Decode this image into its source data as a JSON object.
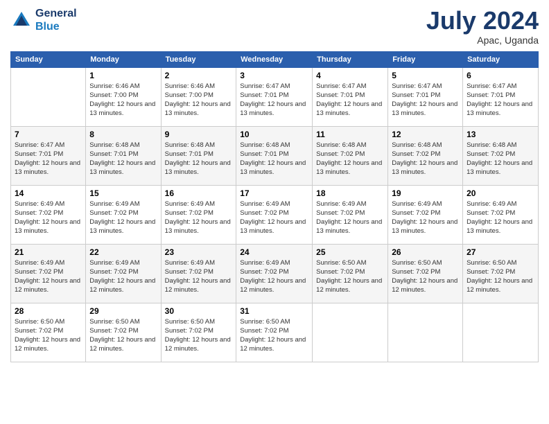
{
  "header": {
    "logo_line1": "General",
    "logo_line2": "Blue",
    "month_title": "July 2024",
    "subtitle": "Apac, Uganda"
  },
  "days_of_week": [
    "Sunday",
    "Monday",
    "Tuesday",
    "Wednesday",
    "Thursday",
    "Friday",
    "Saturday"
  ],
  "weeks": [
    [
      {
        "day": "",
        "sunrise": "",
        "sunset": "",
        "daylight": ""
      },
      {
        "day": "1",
        "sunrise": "Sunrise: 6:46 AM",
        "sunset": "Sunset: 7:00 PM",
        "daylight": "Daylight: 12 hours and 13 minutes."
      },
      {
        "day": "2",
        "sunrise": "Sunrise: 6:46 AM",
        "sunset": "Sunset: 7:00 PM",
        "daylight": "Daylight: 12 hours and 13 minutes."
      },
      {
        "day": "3",
        "sunrise": "Sunrise: 6:47 AM",
        "sunset": "Sunset: 7:01 PM",
        "daylight": "Daylight: 12 hours and 13 minutes."
      },
      {
        "day": "4",
        "sunrise": "Sunrise: 6:47 AM",
        "sunset": "Sunset: 7:01 PM",
        "daylight": "Daylight: 12 hours and 13 minutes."
      },
      {
        "day": "5",
        "sunrise": "Sunrise: 6:47 AM",
        "sunset": "Sunset: 7:01 PM",
        "daylight": "Daylight: 12 hours and 13 minutes."
      },
      {
        "day": "6",
        "sunrise": "Sunrise: 6:47 AM",
        "sunset": "Sunset: 7:01 PM",
        "daylight": "Daylight: 12 hours and 13 minutes."
      }
    ],
    [
      {
        "day": "7",
        "sunrise": "Sunrise: 6:47 AM",
        "sunset": "Sunset: 7:01 PM",
        "daylight": "Daylight: 12 hours and 13 minutes."
      },
      {
        "day": "8",
        "sunrise": "Sunrise: 6:48 AM",
        "sunset": "Sunset: 7:01 PM",
        "daylight": "Daylight: 12 hours and 13 minutes."
      },
      {
        "day": "9",
        "sunrise": "Sunrise: 6:48 AM",
        "sunset": "Sunset: 7:01 PM",
        "daylight": "Daylight: 12 hours and 13 minutes."
      },
      {
        "day": "10",
        "sunrise": "Sunrise: 6:48 AM",
        "sunset": "Sunset: 7:01 PM",
        "daylight": "Daylight: 12 hours and 13 minutes."
      },
      {
        "day": "11",
        "sunrise": "Sunrise: 6:48 AM",
        "sunset": "Sunset: 7:02 PM",
        "daylight": "Daylight: 12 hours and 13 minutes."
      },
      {
        "day": "12",
        "sunrise": "Sunrise: 6:48 AM",
        "sunset": "Sunset: 7:02 PM",
        "daylight": "Daylight: 12 hours and 13 minutes."
      },
      {
        "day": "13",
        "sunrise": "Sunrise: 6:48 AM",
        "sunset": "Sunset: 7:02 PM",
        "daylight": "Daylight: 12 hours and 13 minutes."
      }
    ],
    [
      {
        "day": "14",
        "sunrise": "Sunrise: 6:49 AM",
        "sunset": "Sunset: 7:02 PM",
        "daylight": "Daylight: 12 hours and 13 minutes."
      },
      {
        "day": "15",
        "sunrise": "Sunrise: 6:49 AM",
        "sunset": "Sunset: 7:02 PM",
        "daylight": "Daylight: 12 hours and 13 minutes."
      },
      {
        "day": "16",
        "sunrise": "Sunrise: 6:49 AM",
        "sunset": "Sunset: 7:02 PM",
        "daylight": "Daylight: 12 hours and 13 minutes."
      },
      {
        "day": "17",
        "sunrise": "Sunrise: 6:49 AM",
        "sunset": "Sunset: 7:02 PM",
        "daylight": "Daylight: 12 hours and 13 minutes."
      },
      {
        "day": "18",
        "sunrise": "Sunrise: 6:49 AM",
        "sunset": "Sunset: 7:02 PM",
        "daylight": "Daylight: 12 hours and 13 minutes."
      },
      {
        "day": "19",
        "sunrise": "Sunrise: 6:49 AM",
        "sunset": "Sunset: 7:02 PM",
        "daylight": "Daylight: 12 hours and 13 minutes."
      },
      {
        "day": "20",
        "sunrise": "Sunrise: 6:49 AM",
        "sunset": "Sunset: 7:02 PM",
        "daylight": "Daylight: 12 hours and 13 minutes."
      }
    ],
    [
      {
        "day": "21",
        "sunrise": "Sunrise: 6:49 AM",
        "sunset": "Sunset: 7:02 PM",
        "daylight": "Daylight: 12 hours and 12 minutes."
      },
      {
        "day": "22",
        "sunrise": "Sunrise: 6:49 AM",
        "sunset": "Sunset: 7:02 PM",
        "daylight": "Daylight: 12 hours and 12 minutes."
      },
      {
        "day": "23",
        "sunrise": "Sunrise: 6:49 AM",
        "sunset": "Sunset: 7:02 PM",
        "daylight": "Daylight: 12 hours and 12 minutes."
      },
      {
        "day": "24",
        "sunrise": "Sunrise: 6:49 AM",
        "sunset": "Sunset: 7:02 PM",
        "daylight": "Daylight: 12 hours and 12 minutes."
      },
      {
        "day": "25",
        "sunrise": "Sunrise: 6:50 AM",
        "sunset": "Sunset: 7:02 PM",
        "daylight": "Daylight: 12 hours and 12 minutes."
      },
      {
        "day": "26",
        "sunrise": "Sunrise: 6:50 AM",
        "sunset": "Sunset: 7:02 PM",
        "daylight": "Daylight: 12 hours and 12 minutes."
      },
      {
        "day": "27",
        "sunrise": "Sunrise: 6:50 AM",
        "sunset": "Sunset: 7:02 PM",
        "daylight": "Daylight: 12 hours and 12 minutes."
      }
    ],
    [
      {
        "day": "28",
        "sunrise": "Sunrise: 6:50 AM",
        "sunset": "Sunset: 7:02 PM",
        "daylight": "Daylight: 12 hours and 12 minutes."
      },
      {
        "day": "29",
        "sunrise": "Sunrise: 6:50 AM",
        "sunset": "Sunset: 7:02 PM",
        "daylight": "Daylight: 12 hours and 12 minutes."
      },
      {
        "day": "30",
        "sunrise": "Sunrise: 6:50 AM",
        "sunset": "Sunset: 7:02 PM",
        "daylight": "Daylight: 12 hours and 12 minutes."
      },
      {
        "day": "31",
        "sunrise": "Sunrise: 6:50 AM",
        "sunset": "Sunset: 7:02 PM",
        "daylight": "Daylight: 12 hours and 12 minutes."
      },
      {
        "day": "",
        "sunrise": "",
        "sunset": "",
        "daylight": ""
      },
      {
        "day": "",
        "sunrise": "",
        "sunset": "",
        "daylight": ""
      },
      {
        "day": "",
        "sunrise": "",
        "sunset": "",
        "daylight": ""
      }
    ]
  ]
}
